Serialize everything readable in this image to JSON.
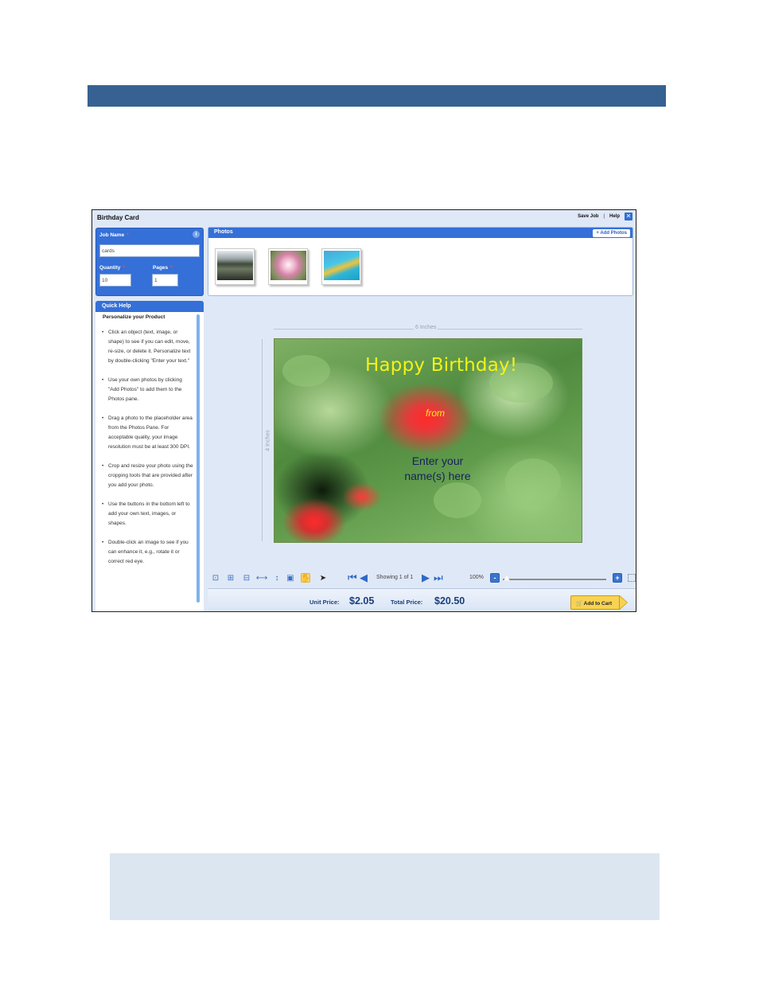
{
  "app": {
    "title": "Birthday Card",
    "save_job": "Save Job",
    "separator": "|",
    "help": "Help",
    "close_glyph": "✕"
  },
  "job": {
    "job_name_label": "Job Name",
    "required_mark": "*",
    "info_glyph": "i",
    "job_name_value": "cards",
    "quantity_label": "Quantity",
    "quantity_value": "10",
    "pages_label": "Pages",
    "pages_value": "1"
  },
  "quick_help": {
    "header": "Quick Help",
    "title": "Personalize your Product",
    "items": [
      "Click an object (text, image, or shape) to see if you can edit, move, re-size, or delete it. Personalize text by double-clicking \"Enter your text.\"",
      "Use your own photos by clicking \"Add Photos\" to add them to the Photos pane.",
      "Drag a photo to the placeholder area from the Photos Pane. For acceptable quality, your image resolution must be at least 300 DPI.",
      "Crop and resize your photo using the cropping tools that are provided after you add your photo.",
      "Use the buttons in the bottom left to add your own text, images, or shapes.",
      "Double-click an image to see if you can enhance it, e.g., rotate it or correct red eye."
    ]
  },
  "photos": {
    "header": "Photos",
    "add_button": "+ Add Photos",
    "thumbnails": [
      {
        "name": "photo-lake"
      },
      {
        "name": "photo-flower"
      },
      {
        "name": "photo-colorful"
      }
    ]
  },
  "canvas": {
    "width_label": "6 Inches",
    "height_label": "4 Inches",
    "headline": "Happy Birthday!",
    "from_text": "from",
    "name_line1": "Enter your",
    "name_line2": "name(s) here"
  },
  "toolbar": {
    "showing": "Showing 1 of 1",
    "zoom": "100%",
    "zoom_out": "-",
    "zoom_in": "+",
    "zoom_level": 0.02,
    "first_glyph": "⏮",
    "prev_glyph": "◀",
    "next_glyph": "▶",
    "last_glyph": "⏭",
    "icons": [
      "fit-page-icon",
      "fit-width-icon",
      "actual-size-icon",
      "horizontal-resize-icon",
      "vertical-resize-icon",
      "shape-icon",
      "hand-pan-icon",
      "pointer-icon"
    ]
  },
  "price": {
    "unit_label": "Unit Price:",
    "unit_value": "$2.05",
    "total_label": "Total Price:",
    "total_value": "$20.50",
    "cart_button": "Add to Cart",
    "cart_glyph": "🛒"
  },
  "colors": {
    "banner": "#376192",
    "panel_blue": "#3570d8",
    "app_bg": "#dfe8f6",
    "headline_yellow": "#f2f21a",
    "price_text": "#1b3f7a",
    "cart_yellow": "#f7d253"
  }
}
